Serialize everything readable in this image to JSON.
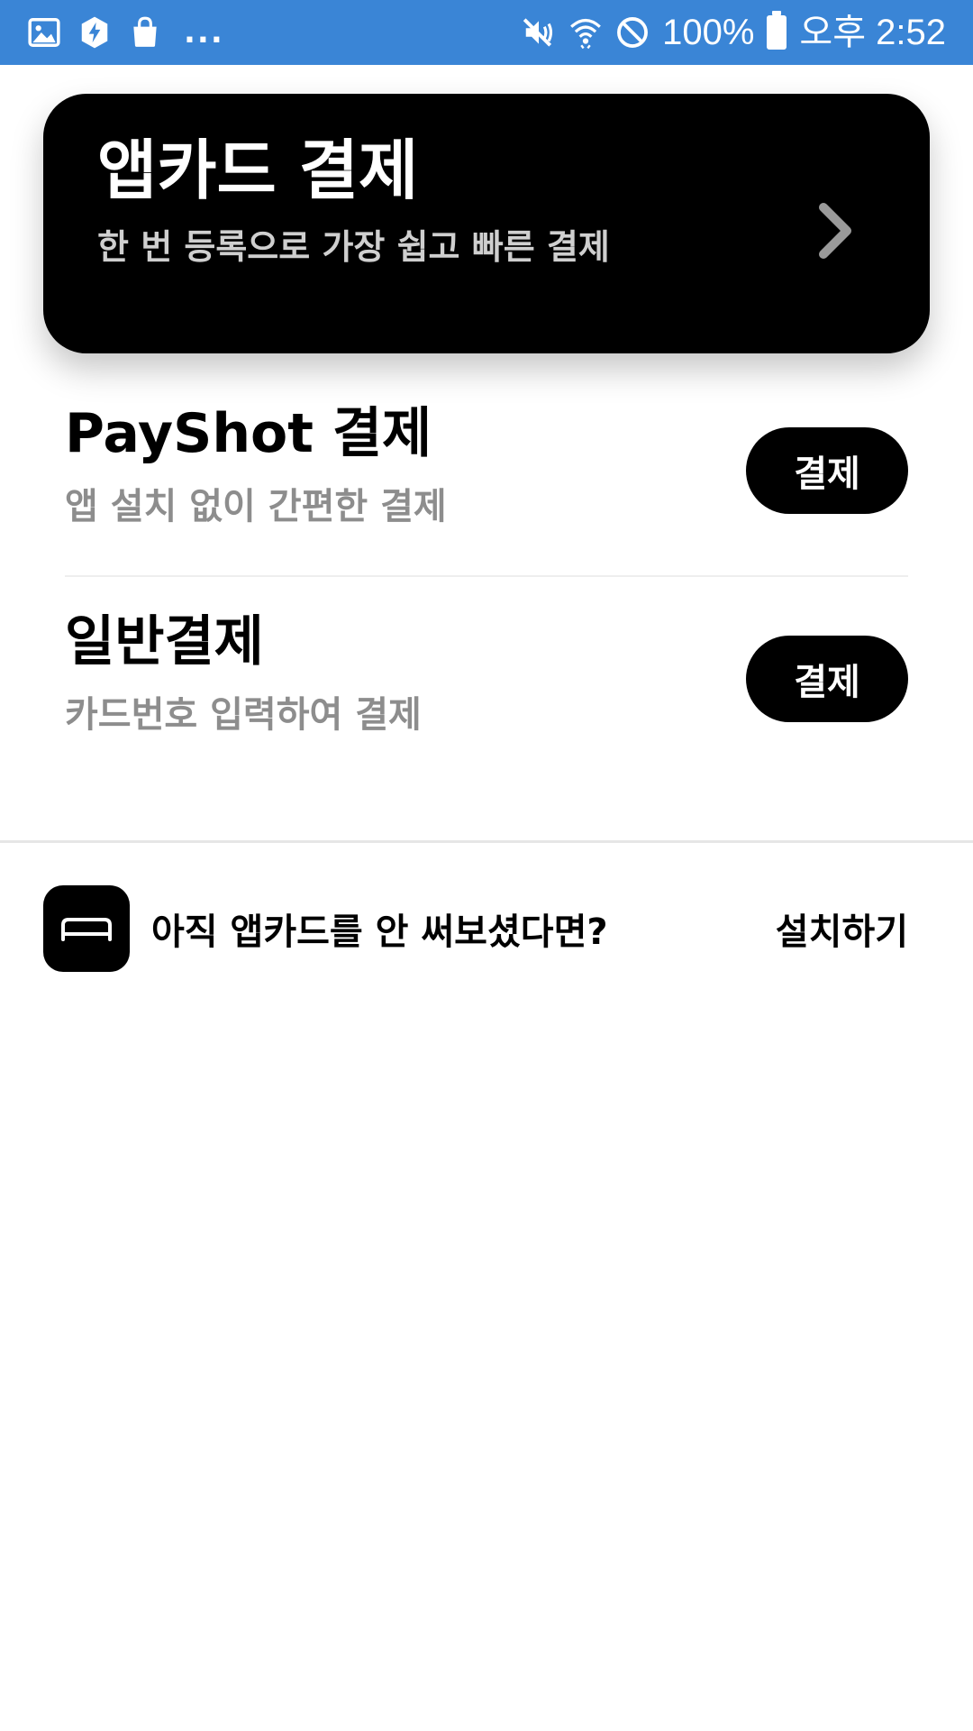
{
  "status_bar": {
    "left_icons": [
      "gallery-icon",
      "shield-bolt-icon",
      "shopping-bag-icon"
    ],
    "more_indicator": "...",
    "right_icons": [
      "vibrate-mute-icon",
      "wifi-icon",
      "do-not-disturb-icon",
      "battery-icon"
    ],
    "battery_text": "100%",
    "time": "오후 2:52",
    "background_color": "#3a85d6"
  },
  "hero_card": {
    "title": "앱카드 결제",
    "subtitle": "한 번 등록으로 가장 쉽고 빠른 결제",
    "icon": "chevron-right-icon"
  },
  "options": [
    {
      "title": "PayShot 결제",
      "subtitle": "앱 설치 없이 간편한 결제",
      "button_label": "결제"
    },
    {
      "title": "일반결제",
      "subtitle": "카드번호 입력하여 결제",
      "button_label": "결제"
    }
  ],
  "install_promo": {
    "logo_icon": "appcard-logo-icon",
    "text": "아직 앱카드를 안 써보셨다면?",
    "link_label": "설치하기"
  }
}
